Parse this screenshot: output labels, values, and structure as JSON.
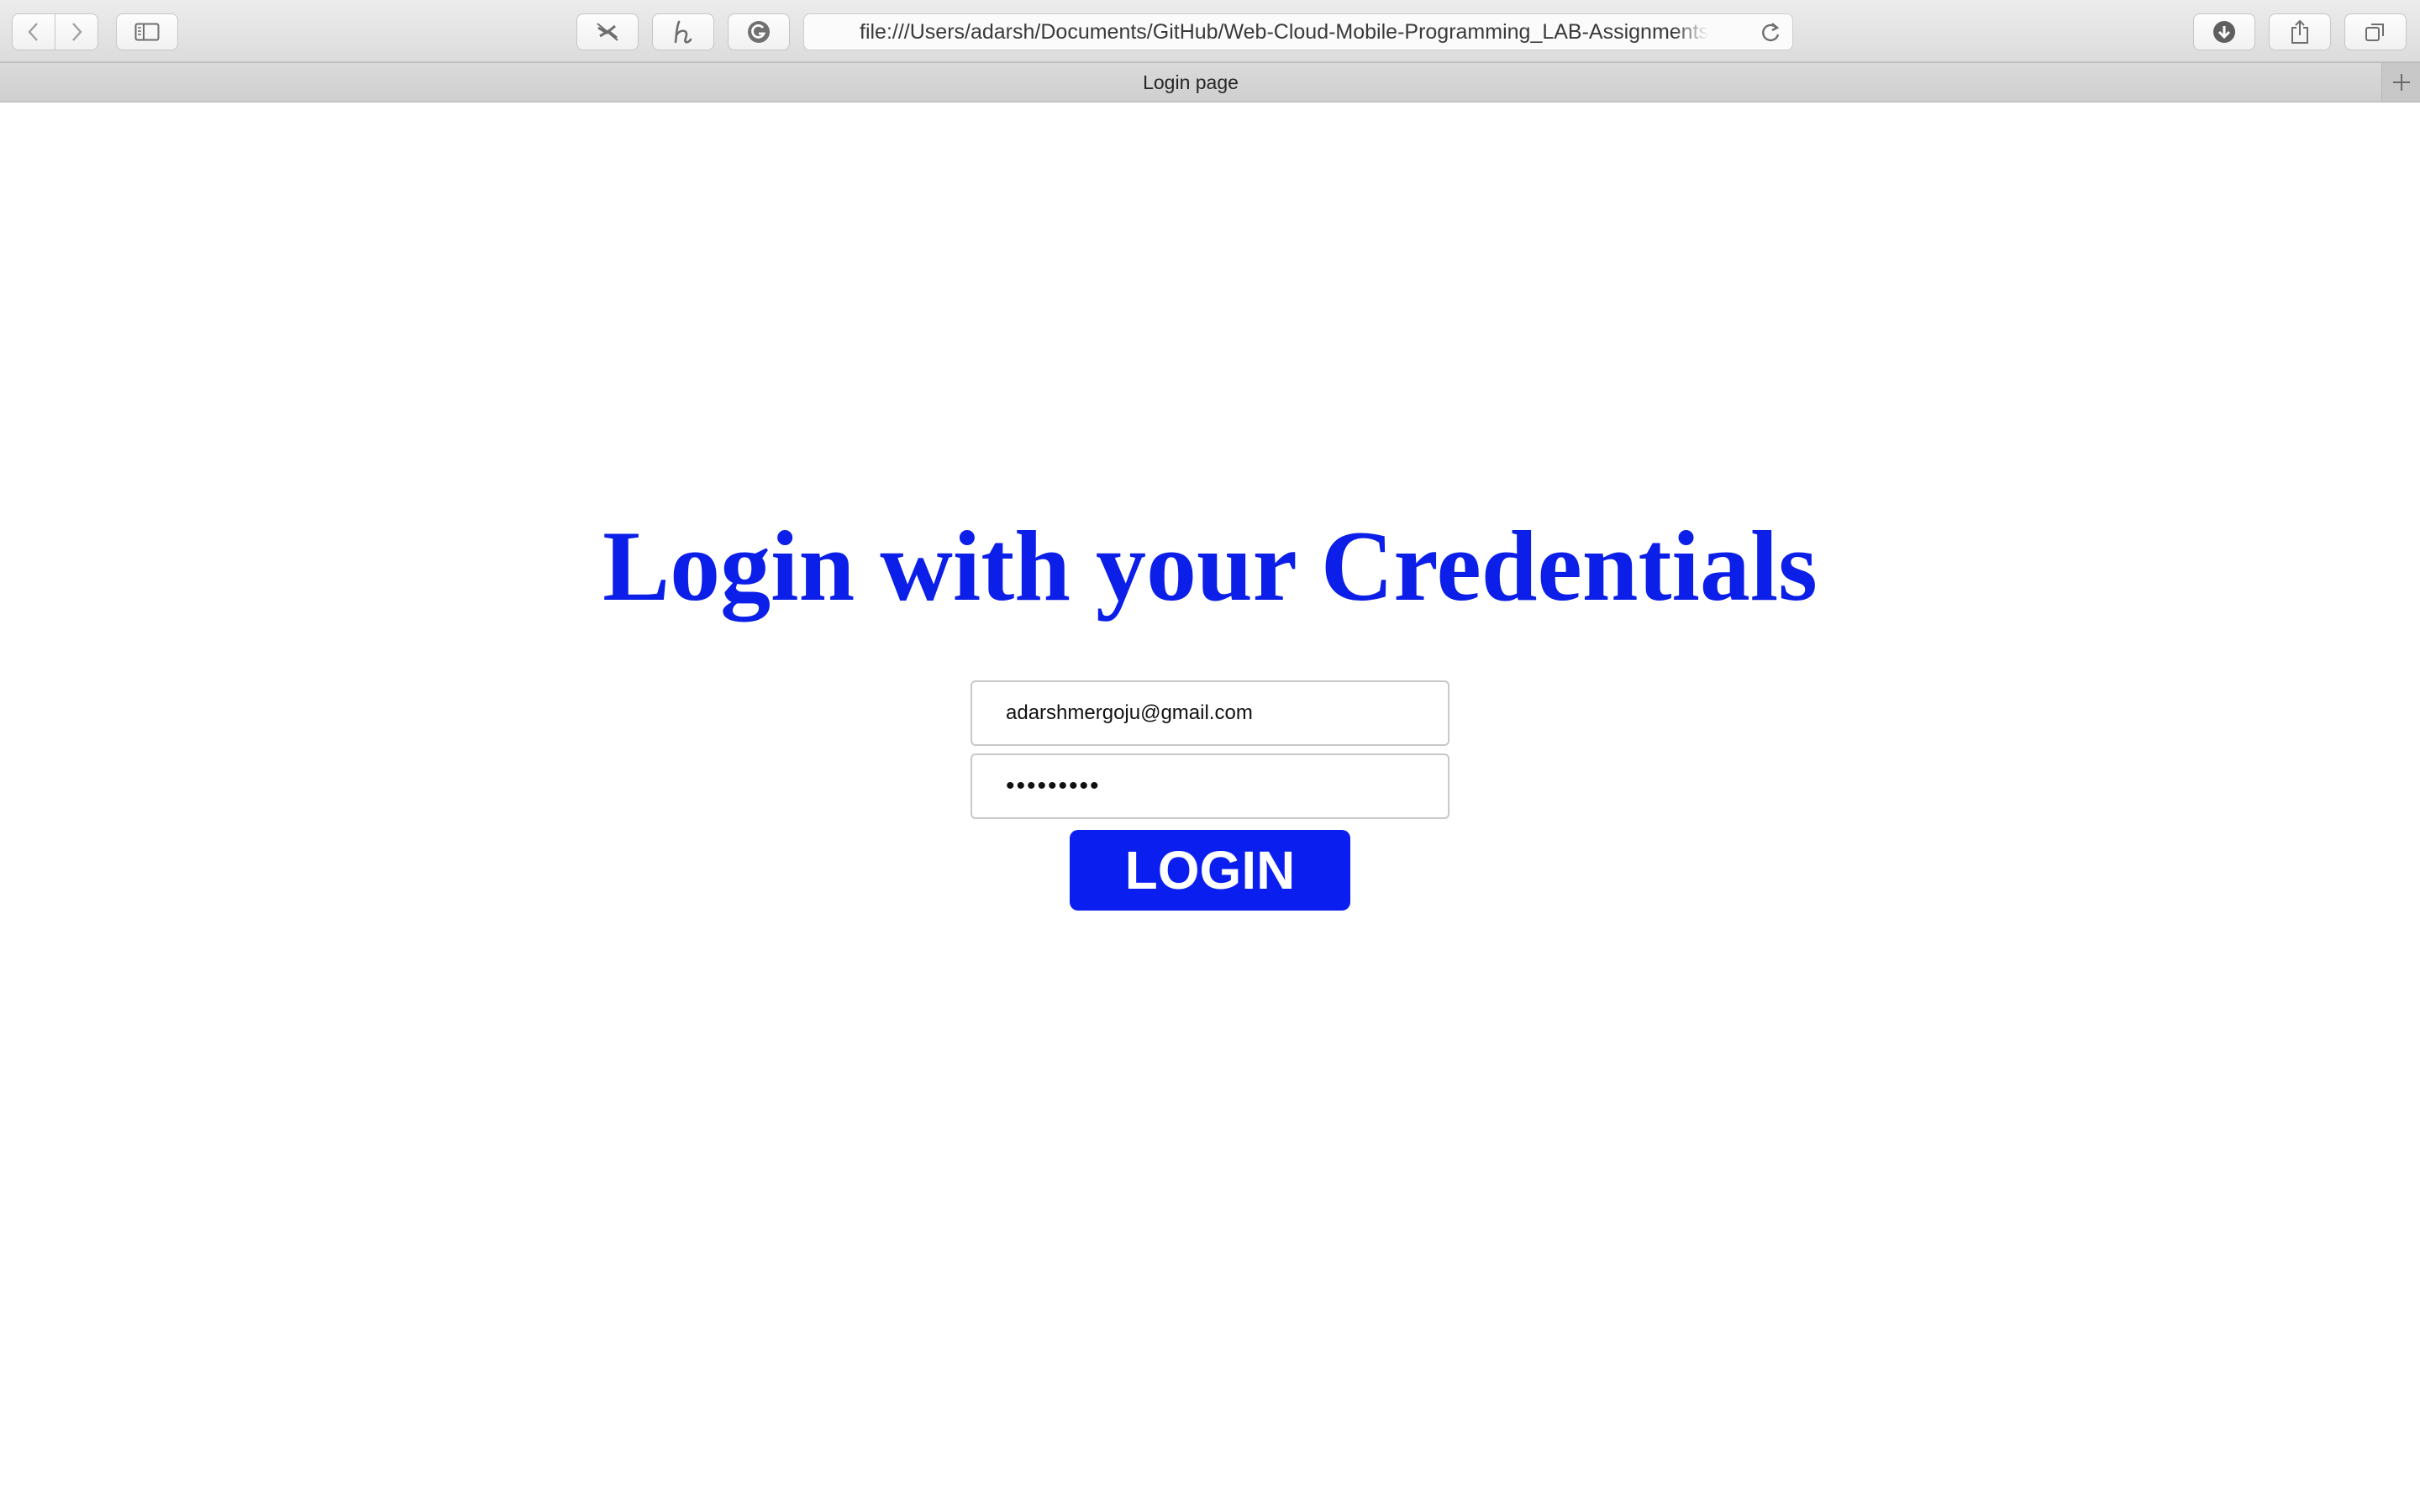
{
  "browser": {
    "url": "file:///Users/adarsh/Documents/GitHub/Web-Cloud-Mobile-Programming_LAB-Assignments/",
    "tab_title": "Login page",
    "icons": [
      "back-icon",
      "forward-icon",
      "sidebar-icon",
      "extension-icon",
      "honey-icon",
      "grammarly-icon",
      "reload-icon",
      "downloads-icon",
      "share-icon",
      "tabs-overview-icon",
      "new-tab-icon"
    ]
  },
  "page": {
    "heading": "Login with your Credentials",
    "heading_color": "#0b1fe8",
    "email_value": "adarshmergoju@gmail.com",
    "password_masked": "•••••••••",
    "login_label": "LOGIN",
    "login_color": "#0a1ef0"
  }
}
